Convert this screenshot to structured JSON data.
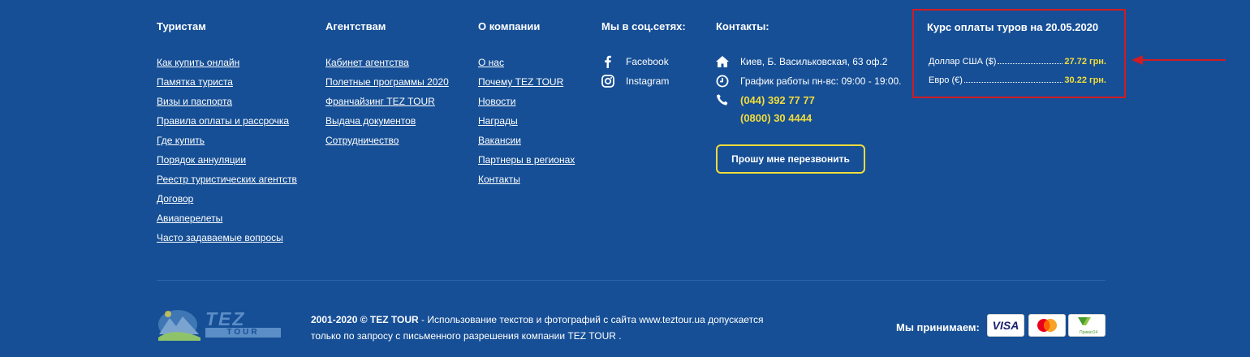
{
  "columns": {
    "tourists": {
      "title": "Туристам",
      "links": [
        "Как купить онлайн",
        "Памятка туриста",
        "Визы и паспорта",
        "Правила оплаты и рассрочка",
        "Где купить",
        "Порядок аннуляции",
        "Реестр туристических агентств",
        "Договор",
        "Авиаперелеты",
        "Часто задаваемые вопросы"
      ]
    },
    "agencies": {
      "title": "Агентствам",
      "links": [
        "Кабинет агентства",
        "Полетные программы 2020",
        "Франчайзинг TEZ TOUR",
        "Выдача документов",
        "Сотрудничество"
      ]
    },
    "company": {
      "title": "О компании",
      "links": [
        "О нас",
        "Почему TEZ TOUR",
        "Новости",
        "Награды",
        "Вакансии",
        "Партнеры в регионах",
        "Контакты"
      ]
    },
    "social": {
      "title": "Мы в соц.сетях:",
      "items": [
        {
          "label": "Facebook",
          "icon": "facebook-icon"
        },
        {
          "label": "Instagram",
          "icon": "instagram-icon"
        }
      ]
    },
    "contacts": {
      "title": "Контакты:",
      "address": "Киев, Б. Васильковская, 63 оф.2",
      "hours": "График работы пн-вс: 09:00 - 19:00.",
      "phone1": "(044) 392 77 77",
      "phone2": "(0800) 30 4444",
      "callback_label": "Прошу мне перезвонить"
    }
  },
  "rates": {
    "title": "Курс оплаты туров на 20.05.2020",
    "items": [
      {
        "currency": "Доллар США ($)",
        "value": "27.72 грн."
      },
      {
        "currency": "Евро (€)",
        "value": "30.22 грн."
      }
    ]
  },
  "footer": {
    "copyright_bold": "2001-2020 © TEZ TOUR",
    "copyright_text1": " - Использование текстов и фотографий с сайта www.teztour.ua допускается",
    "copyright_text2": "только по запросу с письменного разрешения компании TEZ TOUR .",
    "accept_label": "Мы принимаем:",
    "logo_text1": "TEZ",
    "logo_text2": "TOUR",
    "payment": [
      {
        "name": "VISA",
        "icon": "visa-icon"
      },
      {
        "name": "Mastercard",
        "icon": "mastercard-icon"
      },
      {
        "name": "Приват24",
        "icon": "privat24-icon"
      }
    ]
  },
  "colors": {
    "background": "#164f96",
    "accent_yellow": "#f2dc3c",
    "highlight_red": "#d21b22"
  }
}
